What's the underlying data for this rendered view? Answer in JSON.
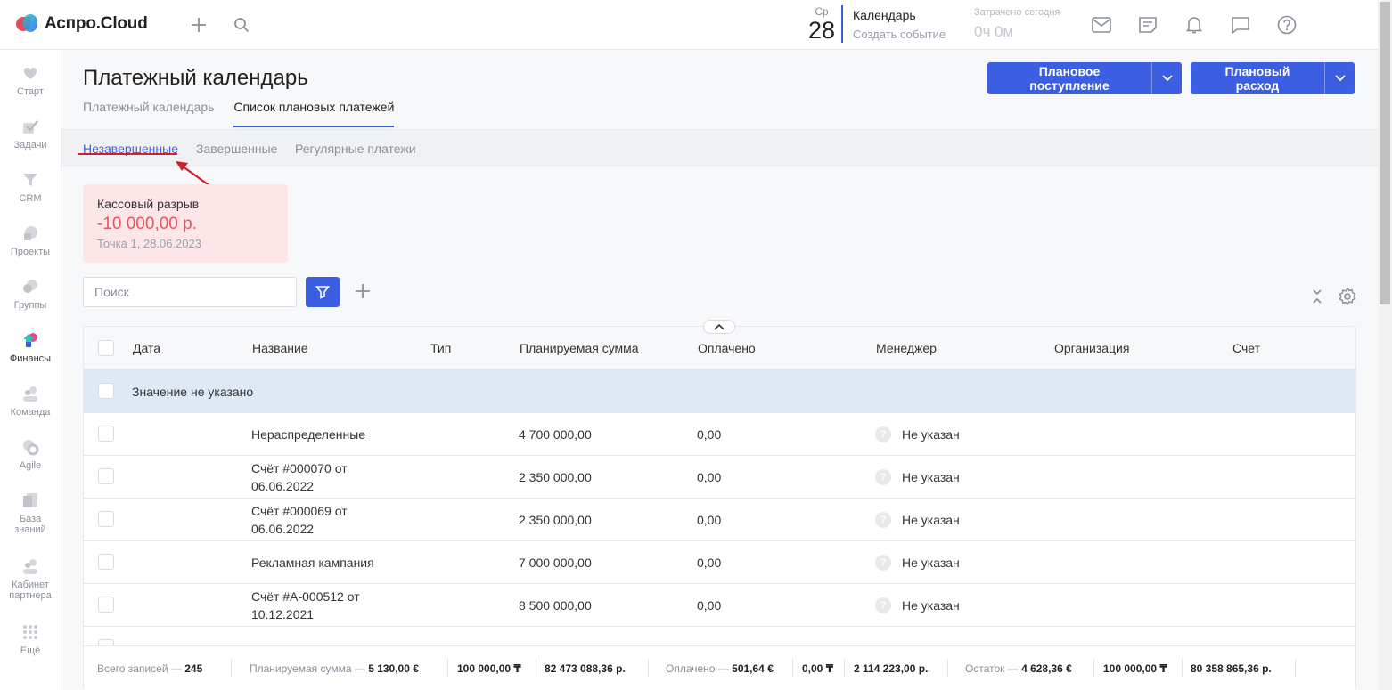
{
  "app": {
    "logo_text": "Аспро.Cloud"
  },
  "topbar": {
    "day_of_week": "Ср",
    "day_number": "28",
    "calendar_title": "Календарь",
    "calendar_action": "Создать событие",
    "spent_label": "Затрачено сегодня",
    "spent_value": "0ч 0м",
    "icons": [
      "plus-icon",
      "search-icon",
      "mail-icon",
      "note-icon",
      "bell-icon",
      "chat-icon",
      "help-icon"
    ]
  },
  "sidebar": {
    "items": [
      {
        "label": "Старт",
        "icon": "heart-icon"
      },
      {
        "label": "Задачи",
        "icon": "check-icon"
      },
      {
        "label": "CRM",
        "icon": "funnel-icon"
      },
      {
        "label": "Проекты",
        "icon": "projects-icon"
      },
      {
        "label": "Группы",
        "icon": "groups-icon"
      },
      {
        "label": "Финансы",
        "icon": "finance-icon"
      },
      {
        "label": "Команда",
        "icon": "team-icon"
      },
      {
        "label": "Agile",
        "icon": "agile-icon"
      },
      {
        "label": "База знаний",
        "icon": "book-icon"
      },
      {
        "label": "Кабинет партнера",
        "icon": "partner-icon"
      },
      {
        "label": "Ещё",
        "icon": "grid-icon"
      }
    ]
  },
  "page": {
    "title": "Платежный календарь",
    "tabs": [
      {
        "label": "Платежный календарь",
        "active": false
      },
      {
        "label": "Список плановых платежей",
        "active": true
      }
    ],
    "buttons": {
      "income": "Плановое поступление",
      "expense": "Плановый расход"
    },
    "subtabs": [
      {
        "label": "Незавершенные",
        "active": true
      },
      {
        "label": "Завершенные",
        "active": false
      },
      {
        "label": "Регулярные платежи",
        "active": false
      }
    ]
  },
  "cash_gap": {
    "title": "Кассовый разрыв",
    "value": "-10 000,00 р.",
    "sub": "Точка 1, 28.06.2023"
  },
  "search": {
    "placeholder": "Поиск"
  },
  "table": {
    "columns": [
      "Дата",
      "Название",
      "Тип",
      "Планируемая сумма",
      "Оплачено",
      "Менеджер",
      "Организация",
      "Счет"
    ],
    "group_label": "Значение не указано",
    "rows": [
      {
        "name": "Нераспределенные",
        "amount": "4 700 000,00",
        "paid": "0,00",
        "manager": "Не указан"
      },
      {
        "name": "Счёт #000070 от 06.06.2022",
        "amount": "2 350 000,00",
        "paid": "0,00",
        "manager": "Не указан"
      },
      {
        "name": "Счёт #000069 от 06.06.2022",
        "amount": "2 350 000,00",
        "paid": "0,00",
        "manager": "Не указан"
      },
      {
        "name": "Рекламная кампания",
        "amount": "7 000 000,00",
        "paid": "0,00",
        "manager": "Не указан"
      },
      {
        "name": "Счёт #А-000512 от 10.12.2021",
        "amount": "8 500 000,00",
        "paid": "0,00",
        "manager": "Не указан"
      }
    ]
  },
  "footer": {
    "total_label": "Всего записей —",
    "total_value": "245",
    "planned_label": "Планируемая сумма —",
    "planned_values": [
      "5 130,00 €",
      "100 000,00 ₸",
      "82 473 088,36 р."
    ],
    "paid_label": "Оплачено —",
    "paid_values": [
      "501,64 €",
      "0,00 ₸",
      "2 114 223,00 р."
    ],
    "rest_label": "Остаток —",
    "rest_values": [
      "4 628,36 €",
      "100 000,00 ₸",
      "80 358 865,36 р."
    ]
  },
  "colors": {
    "accent": "#3b5fe0",
    "danger": "#e8535f",
    "group_row": "#dfe9f5",
    "annotation_red": "#d21f2a"
  }
}
